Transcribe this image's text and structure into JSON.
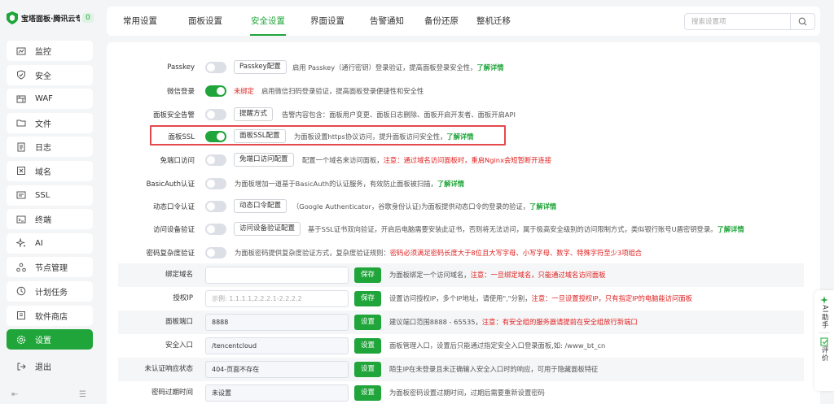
{
  "brand": {
    "name": "宝塔面板·腾讯云专",
    "badge": "0"
  },
  "nav": [
    {
      "key": "monitor",
      "label": "监控",
      "icon": "monitor-icon"
    },
    {
      "key": "security",
      "label": "安全",
      "icon": "shield-icon"
    },
    {
      "key": "waf",
      "label": "WAF",
      "icon": "waf-icon"
    },
    {
      "key": "files",
      "label": "文件",
      "icon": "folder-icon"
    },
    {
      "key": "logs",
      "label": "日志",
      "icon": "log-icon"
    },
    {
      "key": "domain",
      "label": "域名",
      "icon": "domain-icon"
    },
    {
      "key": "ssl",
      "label": "SSL",
      "icon": "ssl-icon"
    },
    {
      "key": "terminal",
      "label": "终端",
      "icon": "terminal-icon"
    },
    {
      "key": "ai",
      "label": "AI",
      "icon": "ai-sparkle-icon"
    },
    {
      "key": "nodes",
      "label": "节点管理",
      "icon": "node-icon"
    },
    {
      "key": "cron",
      "label": "计划任务",
      "icon": "clock-icon"
    },
    {
      "key": "store",
      "label": "软件商店",
      "icon": "store-icon"
    },
    {
      "key": "settings",
      "label": "设置",
      "icon": "gear-icon",
      "active": true
    }
  ],
  "logout": {
    "label": "退出",
    "icon": "logout-icon"
  },
  "tabs": [
    {
      "label": "常用设置"
    },
    {
      "label": "面板设置"
    },
    {
      "label": "安全设置",
      "active": true
    },
    {
      "label": "界面设置"
    },
    {
      "label": "告警通知"
    },
    {
      "label": "备份还原"
    },
    {
      "label": "整机迁移"
    }
  ],
  "search": {
    "placeholder": "搜索设置项"
  },
  "toggles": {
    "passkey": {
      "label": "Passkey",
      "button": "Passkey配置",
      "desc": "启用 Passkey（通行密钥）登录验证，提高面板登录安全性，",
      "link": "了解详情"
    },
    "wechat": {
      "label": "微信登录",
      "status": "未绑定",
      "desc": "启用微信扫码登录验证，提高面板登录便捷性和安全性"
    },
    "alarm": {
      "label": "面板安全告警",
      "button": "提醒方式",
      "desc": "告警内容包含：面板用户变更、面板日志删除、面板开启开发者、面板开启API"
    },
    "ssl": {
      "label": "面板SSL",
      "button": "面板SSL配置",
      "desc": "为面板设置https协议访问，提升面板访问安全性，",
      "link": "了解详情"
    },
    "noport": {
      "label": "免端口访问",
      "button": "免端口访问配置",
      "desc": "配置一个域名来访问面板，",
      "warn": "注意：通过域名访问面板时，重启Nginx会短暂断开连接"
    },
    "basicauth": {
      "label": "BasicAuth认证",
      "desc": "为面板增加一道基于BasicAuth的认证服务，有效防止面板被扫描，",
      "link": "了解详情"
    },
    "totp": {
      "label": "动态口令认证",
      "button": "动态口令配置",
      "desc": "（Google Authenticator，谷歌身份认证)为面板提供动态口令的登录的验证，",
      "link": "了解详情"
    },
    "device": {
      "label": "访问设备验证",
      "button": "访问设备验证配置",
      "desc": "基于SSL证书双向验证，开启后电脑需要安装此证书，否则将无法访问，属于极高安全级别的访问限制方式，类似银行账号U盾密钥登录。",
      "link": "了解详情"
    },
    "pwdcomplex": {
      "label": "密码复杂度验证",
      "desc": "为面板密码提供复杂度验证方式，复杂度验证规则：",
      "warn": "密码必须满足密码长度大于8位且大写字母、小写字母、数字、特殊字符至少3项组合"
    }
  },
  "forms": {
    "domain": {
      "label": "绑定域名",
      "value": "",
      "placeholder": "",
      "button": "保存",
      "desc": "为面板绑定一个访问域名，",
      "warn": "注意：一旦绑定域名，只能通过域名访问面板"
    },
    "ip": {
      "label": "授权IP",
      "value": "",
      "placeholder": "示例: 1.1.1.1,2.2.2.1-2.2.2.2",
      "button": "保存",
      "desc": "设置访问授权IP，多个IP地址，请使用\",\"分割，",
      "warn": "注意：一旦设置授权IP，只有指定IP的电脑能访问面板"
    },
    "port": {
      "label": "面板端口",
      "value": "8888",
      "button": "设置",
      "desc": "建议端口范围8888 - 65535，",
      "warn": "注意：有安全组的服务器请提前在安全组放行新端口"
    },
    "entry": {
      "label": "安全入口",
      "value": "/tencentcloud",
      "button": "设置",
      "desc": "面板管理入口，设置后只能通过指定安全入口登录面板,如: /www_bt_cn"
    },
    "unauth": {
      "label": "未认证响应状态",
      "value": "404-页面不存在",
      "button": "设置",
      "desc": "陌生IP在未登录且未正确输入安全入口时的响应，可用于隐藏面板特征"
    },
    "pwdexpire": {
      "label": "密码过期时间",
      "value": "未设置",
      "button": "设置",
      "desc": "为面板密码设置过期时间，过期后需要重新设置密码"
    }
  },
  "assistant": {
    "ai": "AI助手",
    "review": "评价"
  },
  "colors": {
    "accent": "#20a53a",
    "warn": "#e02020",
    "highlight": "#e5484d"
  }
}
